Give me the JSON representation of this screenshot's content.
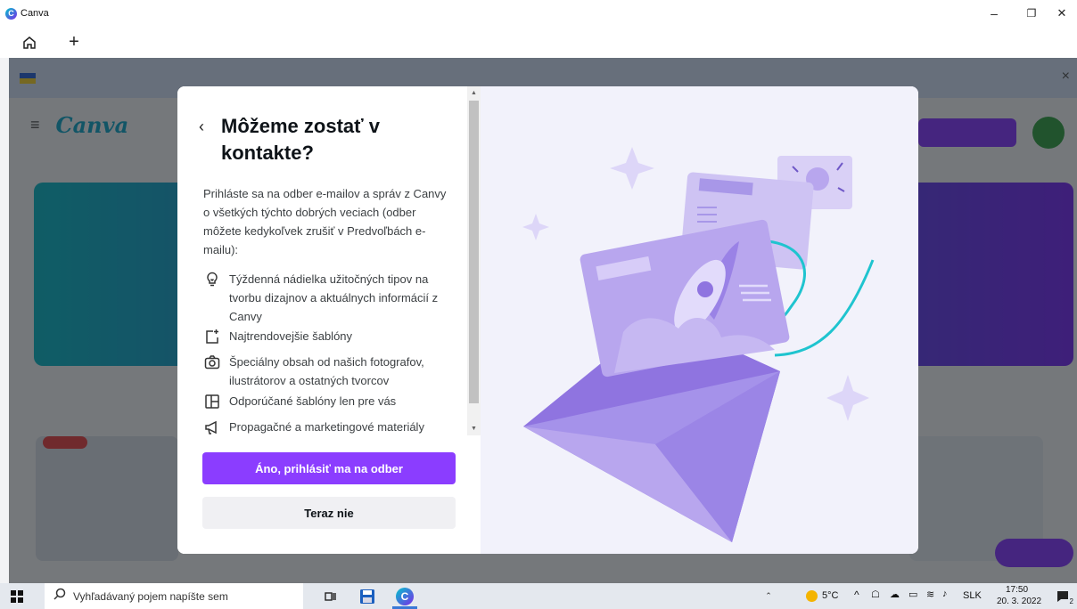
{
  "window": {
    "title": "Canva",
    "minimize_glyph": "–",
    "restore_glyph": "❐",
    "close_glyph": "✕"
  },
  "tabs": {
    "home_icon": "home-icon",
    "new_tab_glyph": "+"
  },
  "modal": {
    "back_glyph": "‹",
    "title": "Môžeme zostať v kontakte?",
    "intro": "Prihláste sa na odber e-mailov a správ z Canvy o všetkých týchto dobrých veciach (odber môžete kedykoľvek zrušiť v Predvoľbách e-mailu):",
    "benefits": [
      {
        "icon": "lightbulb-icon",
        "text": "Týždenná nádielka užitočných tipov na tvorbu dizajnov a aktuálnych informácií z Canvy"
      },
      {
        "icon": "template-sparkle-icon",
        "text": "Najtrendovejšie šablóny"
      },
      {
        "icon": "camera-icon",
        "text": "Špeciálny obsah od našich fotografov, ilustrátorov a ostatných tvorcov"
      },
      {
        "icon": "layout-icon",
        "text": "Odporúčané šablóny len pre vás"
      },
      {
        "icon": "megaphone-icon",
        "text": "Propagačné a marketingové materiály"
      }
    ],
    "primary_button": "Áno, prihlásiť ma na odber",
    "secondary_button": "Teraz nie",
    "accent_color": "#8b3dff"
  },
  "taskbar": {
    "search_placeholder": "Vyhľadávaný pojem napíšte sem",
    "weather": "5°C",
    "language": "SLK",
    "time": "17:50",
    "date": "20. 3. 2022",
    "notification_count": "2"
  }
}
